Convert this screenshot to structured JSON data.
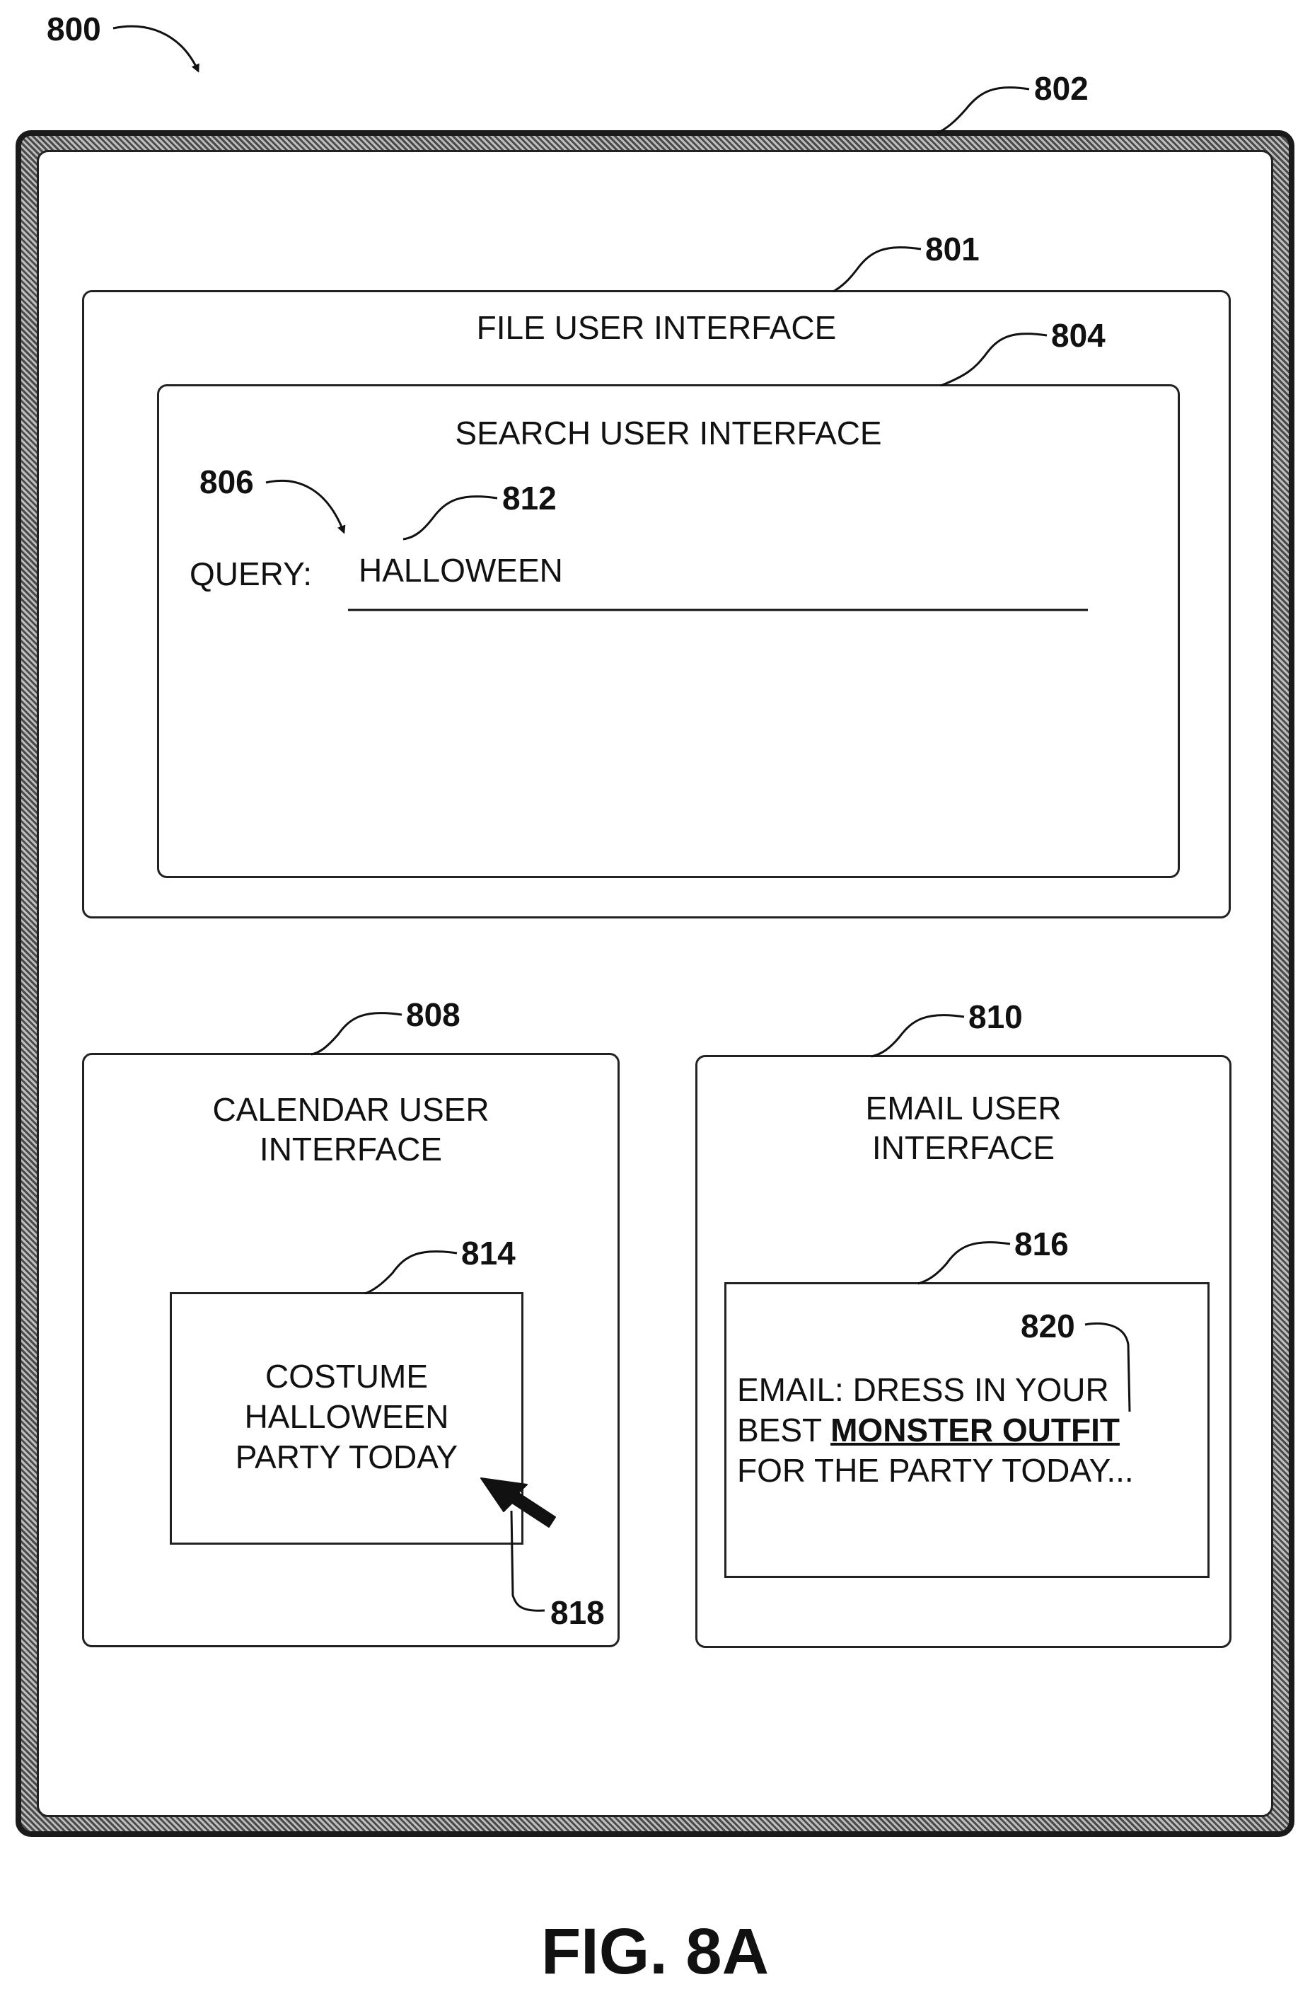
{
  "figure_label": "FIG. 8A",
  "refs": {
    "r800": "800",
    "r802": "802",
    "r801": "801",
    "r804": "804",
    "r806": "806",
    "r812": "812",
    "r808": "808",
    "r810": "810",
    "r814": "814",
    "r816": "816",
    "r820": "820",
    "r818": "818"
  },
  "file_ui": {
    "title": "FILE USER INTERFACE"
  },
  "search_ui": {
    "title": "SEARCH USER INTERFACE",
    "query_label": "QUERY:",
    "query_value": "HALLOWEEN"
  },
  "calendar_ui": {
    "title_line1": "CALENDAR USER",
    "title_line2": "INTERFACE",
    "event_line1": "COSTUME",
    "event_line2": "HALLOWEEN",
    "event_line3": "PARTY TODAY"
  },
  "email_ui": {
    "title_line1": "EMAIL USER",
    "title_line2": "INTERFACE",
    "line1": "EMAIL: DRESS IN YOUR",
    "line2_prefix": "BEST ",
    "line2_highlight": "MONSTER OUTFIT",
    "line3": "FOR THE PARTY TODAY..."
  },
  "icons": [
    "pointer-arrow-icon"
  ]
}
